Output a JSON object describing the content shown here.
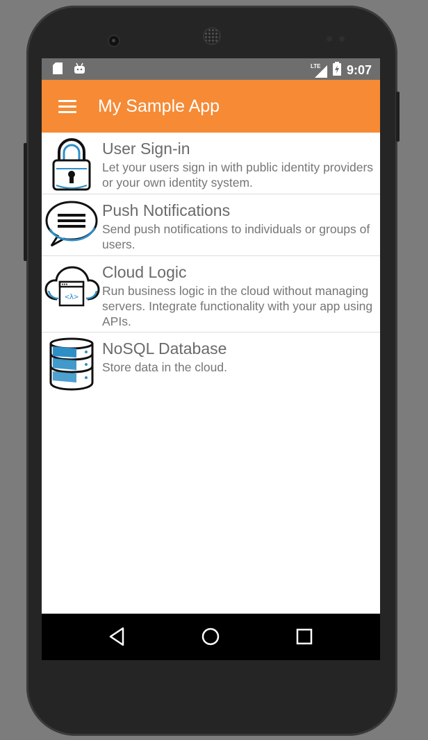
{
  "status_bar": {
    "time": "9:07",
    "network_label": "LTE",
    "icons": [
      "sd-card-icon",
      "android-icon",
      "lte-signal-icon",
      "battery-icon"
    ]
  },
  "app_bar": {
    "title": "My Sample App",
    "menu_icon": "hamburger-menu-icon",
    "color": "#f68a35"
  },
  "features": [
    {
      "title": "User Sign-in",
      "description": "Let your users sign in with public identity providers or your own identity system.",
      "icon": "padlock-icon"
    },
    {
      "title": "Push Notifications",
      "description": "Send push notifications to individuals or groups of users.",
      "icon": "speech-bubble-icon"
    },
    {
      "title": "Cloud Logic",
      "description": "Run business logic in the cloud without managing servers. Integrate functionality with your app using APIs.",
      "icon": "cloud-lambda-icon"
    },
    {
      "title": "NoSQL Database",
      "description": "Store data in the cloud.",
      "icon": "database-icon"
    }
  ],
  "nav_bar": {
    "buttons": [
      "back-icon",
      "home-icon",
      "recents-icon"
    ]
  },
  "colors": {
    "accent": "#f68a35",
    "icon_blue": "#2e8fc7",
    "status_bar": "#6e6e6e"
  }
}
